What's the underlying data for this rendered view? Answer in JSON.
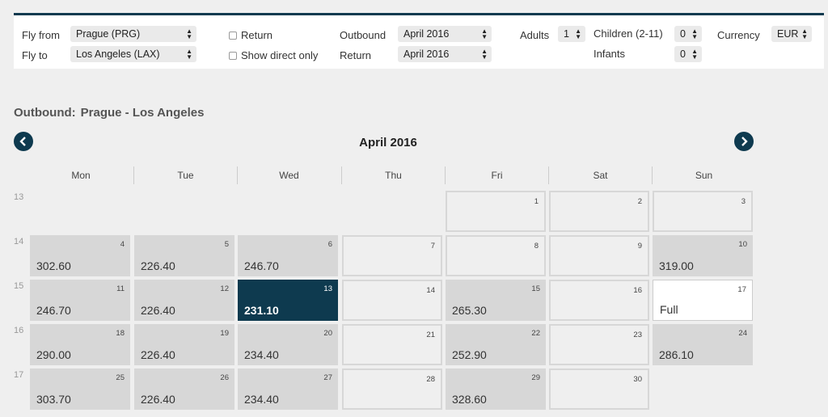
{
  "search": {
    "fly_from_label": "Fly from",
    "fly_from_value": "Prague (PRG)",
    "fly_to_label": "Fly to",
    "fly_to_value": "Los Angeles (LAX)",
    "return_label": "Return",
    "direct_label": "Show direct only",
    "outbound_label": "Outbound",
    "outbound_value": "April 2016",
    "return_date_label": "Return",
    "return_date_value": "April 2016",
    "adults_label": "Adults",
    "adults_value": "1",
    "children_label": "Children (2-11)",
    "children_value": "0",
    "infants_label": "Infants",
    "infants_value": "0",
    "currency_label": "Currency",
    "currency_value": "EUR"
  },
  "outbound": {
    "label": "Outbound:",
    "route": "Prague - Los Angeles"
  },
  "calendar": {
    "month": "April 2016",
    "days": [
      "Mon",
      "Tue",
      "Wed",
      "Thu",
      "Fri",
      "Sat",
      "Sun"
    ],
    "weeks": [
      "13",
      "14",
      "15",
      "16",
      "17"
    ],
    "cells": [
      {
        "day": "1",
        "row": 0,
        "col": 4,
        "value": "",
        "state": "empty"
      },
      {
        "day": "2",
        "row": 0,
        "col": 5,
        "value": "",
        "state": "empty"
      },
      {
        "day": "3",
        "row": 0,
        "col": 6,
        "value": "",
        "state": "empty"
      },
      {
        "day": "4",
        "row": 1,
        "col": 0,
        "value": "302.60",
        "state": "price"
      },
      {
        "day": "5",
        "row": 1,
        "col": 1,
        "value": "226.40",
        "state": "price"
      },
      {
        "day": "6",
        "row": 1,
        "col": 2,
        "value": "246.70",
        "state": "price"
      },
      {
        "day": "7",
        "row": 1,
        "col": 3,
        "value": "",
        "state": "empty"
      },
      {
        "day": "8",
        "row": 1,
        "col": 4,
        "value": "",
        "state": "empty"
      },
      {
        "day": "9",
        "row": 1,
        "col": 5,
        "value": "",
        "state": "empty"
      },
      {
        "day": "10",
        "row": 1,
        "col": 6,
        "value": "319.00",
        "state": "price"
      },
      {
        "day": "11",
        "row": 2,
        "col": 0,
        "value": "246.70",
        "state": "price"
      },
      {
        "day": "12",
        "row": 2,
        "col": 1,
        "value": "226.40",
        "state": "price"
      },
      {
        "day": "13",
        "row": 2,
        "col": 2,
        "value": "231.10",
        "state": "selected"
      },
      {
        "day": "14",
        "row": 2,
        "col": 3,
        "value": "",
        "state": "empty"
      },
      {
        "day": "15",
        "row": 2,
        "col": 4,
        "value": "265.30",
        "state": "price"
      },
      {
        "day": "16",
        "row": 2,
        "col": 5,
        "value": "",
        "state": "empty"
      },
      {
        "day": "17",
        "row": 2,
        "col": 6,
        "value": "Full",
        "state": "full"
      },
      {
        "day": "18",
        "row": 3,
        "col": 0,
        "value": "290.00",
        "state": "price"
      },
      {
        "day": "19",
        "row": 3,
        "col": 1,
        "value": "226.40",
        "state": "price"
      },
      {
        "day": "20",
        "row": 3,
        "col": 2,
        "value": "234.40",
        "state": "price"
      },
      {
        "day": "21",
        "row": 3,
        "col": 3,
        "value": "",
        "state": "empty"
      },
      {
        "day": "22",
        "row": 3,
        "col": 4,
        "value": "252.90",
        "state": "price"
      },
      {
        "day": "23",
        "row": 3,
        "col": 5,
        "value": "",
        "state": "empty"
      },
      {
        "day": "24",
        "row": 3,
        "col": 6,
        "value": "286.10",
        "state": "price"
      },
      {
        "day": "25",
        "row": 4,
        "col": 0,
        "value": "303.70",
        "state": "price"
      },
      {
        "day": "26",
        "row": 4,
        "col": 1,
        "value": "226.40",
        "state": "price"
      },
      {
        "day": "27",
        "row": 4,
        "col": 2,
        "value": "234.40",
        "state": "price"
      },
      {
        "day": "28",
        "row": 4,
        "col": 3,
        "value": "",
        "state": "empty"
      },
      {
        "day": "29",
        "row": 4,
        "col": 4,
        "value": "328.60",
        "state": "price"
      },
      {
        "day": "30",
        "row": 4,
        "col": 5,
        "value": "",
        "state": "empty"
      }
    ]
  },
  "colors": {
    "accent": "#0e3a4f",
    "price_cell": "#d7d7d7",
    "background": "#efefef"
  },
  "icons": {
    "prev": "chevron-left-icon",
    "next": "chevron-right-icon"
  }
}
